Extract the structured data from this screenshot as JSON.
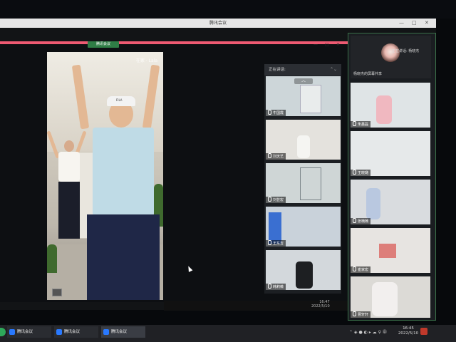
{
  "outer_window": {
    "title": "腾讯会议",
    "controls": [
      "—",
      "□",
      "✕"
    ]
  },
  "share": {
    "tab_label": "腾讯会议",
    "controls": [
      "—",
      "□",
      "✕"
    ]
  },
  "video": {
    "logo_text": "在家 · Lala",
    "cap_text": "FILA"
  },
  "gallery": {
    "header": "正在讲话:",
    "more": "⌃⌄",
    "collapse": "︿",
    "tiles": [
      {
        "name": "牛国霞",
        "bg": "#cdd6d9"
      },
      {
        "name": "刘天艺",
        "bg": "#e4e2dd"
      },
      {
        "name": "刘芸宏",
        "bg": "#cfd6d6"
      },
      {
        "name": "王东吉",
        "bg": "#c9d2da"
      },
      {
        "name": "韩莉薇",
        "bg": "#d3d8dc"
      }
    ]
  },
  "inner_clock": {
    "time": "16:47",
    "date": "2022/5/10"
  },
  "side": {
    "speaking_label": "正在讲话: 杨晓杰",
    "speaker_name": "杨晓杰的屏幕共享",
    "tiles": [
      {
        "name": "朱鑫磊",
        "bg": "#dfe4e6"
      },
      {
        "name": "王晓璐",
        "bg": "#e6e9ea"
      },
      {
        "name": "张楠楠",
        "bg": "#d9dcdf"
      },
      {
        "name": "崔家宏",
        "bg": "#e7e4e1"
      },
      {
        "name": "曹轩轩",
        "bg": "#dcdad6"
      }
    ]
  },
  "taskbar": {
    "items": [
      "腾讯会议",
      "腾讯会议",
      "腾讯会议"
    ],
    "tray": "⌃ ◈ ● ◐ ▸ ☁ ⚲ ㊥",
    "time": "16:45",
    "date": "2022/5/10"
  }
}
